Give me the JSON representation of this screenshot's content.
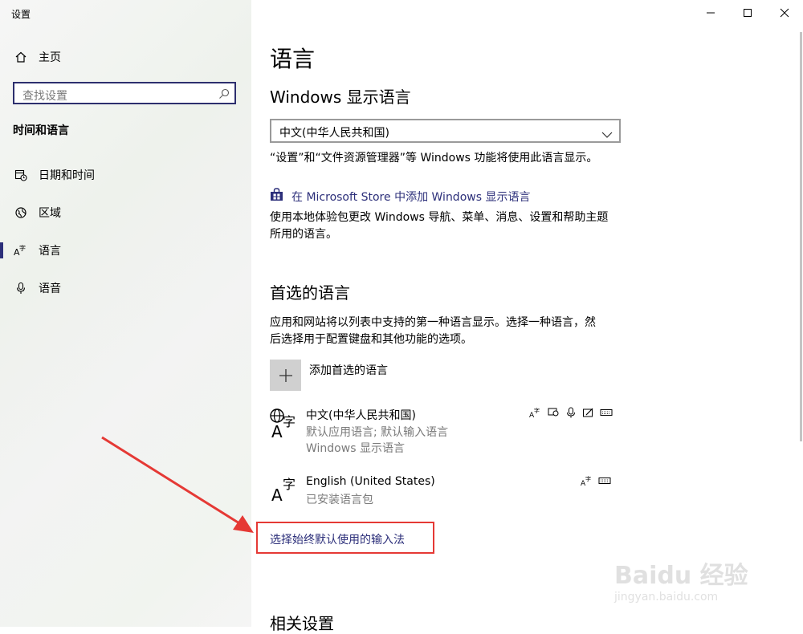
{
  "window": {
    "title": "设置"
  },
  "sidebar": {
    "home": "主页",
    "search_placeholder": "查找设置",
    "section": "时间和语言",
    "items": [
      {
        "label": "日期和时间",
        "icon": "calendar-clock-icon"
      },
      {
        "label": "区域",
        "icon": "globe-icon"
      },
      {
        "label": "语言",
        "icon": "language-icon",
        "active": true
      },
      {
        "label": "语音",
        "icon": "microphone-icon"
      }
    ]
  },
  "main": {
    "title": "语言",
    "display_language": {
      "heading": "Windows 显示语言",
      "selected": "中文(中华人民共和国)",
      "note": "“设置”和“文件资源管理器”等 Windows 功能将使用此语言显示。",
      "store_link": "在 Microsoft Store 中添加 Windows 显示语言",
      "store_desc_1": "使用本地体验包更改 Windows 导航、菜单、消息、设置和帮助主题",
      "store_desc_2": "所用的语言。"
    },
    "preferred": {
      "heading": "首选的语言",
      "desc_1": "应用和网站将以列表中支持的第一种语言显示。选择一种语言，然",
      "desc_2": "后选择用于配置键盘和其他功能的选项。",
      "add_label": "添加首选的语言",
      "languages": [
        {
          "name": "中文(中华人民共和国)",
          "line1": "默认应用语言; 默认输入语言",
          "line2": "Windows 显示语言"
        },
        {
          "name": "English (United States)",
          "line1": "已安装语言包"
        }
      ]
    },
    "ime_link": "选择始终默认使用的输入法",
    "related": "相关设置"
  },
  "watermark": {
    "brand": "Baidu 经验",
    "url": "jingyan.baidu.com"
  },
  "colors": {
    "accent": "#2c2f7a",
    "highlight": "#e53935"
  }
}
